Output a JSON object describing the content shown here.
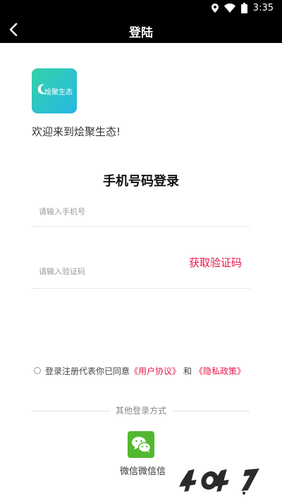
{
  "status_bar": {
    "time": "3:35",
    "icons": [
      "location-icon",
      "wifi-icon",
      "battery-icon"
    ]
  },
  "nav": {
    "back_icon": "chevron-left-icon",
    "title": "登陆"
  },
  "logo": {
    "icon": "moon-icon",
    "text": "烩聚生态",
    "gradient": [
      "#35d3a7",
      "#27b7e6"
    ]
  },
  "welcome": "欢迎来到烩聚生态!",
  "login_title": "手机号码登录",
  "phone": {
    "placeholder": "请输入手机号",
    "value": ""
  },
  "code": {
    "placeholder": "请输入验证码",
    "value": "",
    "get_code_label": "获取验证码"
  },
  "agreement": {
    "checked": false,
    "prefix": "登录注册代表你已同意",
    "user_agreement": "《用户协议》",
    "and": "和",
    "privacy_policy": "《隐私政策》"
  },
  "other_login": {
    "label": "其他登录方式",
    "wechat_icon": "wechat-icon",
    "wechat_label": "微信微信信"
  },
  "colors": {
    "accent": "#e8174b",
    "bar": "#000000",
    "wechat": "#52b82f"
  }
}
